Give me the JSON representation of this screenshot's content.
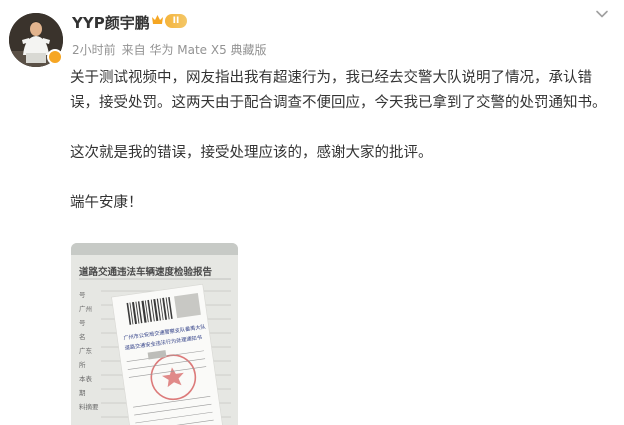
{
  "user": {
    "name": "YYP颜宇鹏",
    "level_badge": "II",
    "time": "2小时前",
    "source_label": "来自 华为 Mate X5 典藏版"
  },
  "post": {
    "paragraphs": [
      "关于测试视频中，网友指出我有超速行为，我已经去交警大队说明了情况，承认错误，接受处罚。这两天由于配合调查不便回应，今天我已拿到了交警的处罚通知书。",
      "这次就是我的错误，接受处理应该的，感谢大家的批评。",
      "端午安康！"
    ]
  },
  "photo": {
    "report_title": "道路交通违法车辆速度检验报告",
    "report_side_labels": [
      "号",
      "广州",
      "号",
      "名",
      "广东",
      "所",
      "本表",
      "期",
      "料摘要"
    ],
    "notice_header": "广州市公安局交通警察支队番禺大队",
    "notice_title": "道路交通安全违法行为处理通知书"
  },
  "colors": {
    "text": "#333333",
    "meta": "#939393",
    "badge": "#f5b43c"
  }
}
